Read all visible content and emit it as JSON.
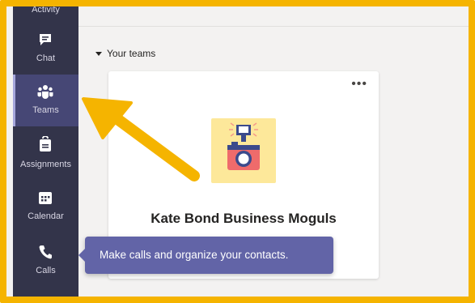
{
  "rail": {
    "items": [
      {
        "label": "Activity",
        "icon": "bell-icon"
      },
      {
        "label": "Chat",
        "icon": "chat-icon"
      },
      {
        "label": "Teams",
        "icon": "teams-icon",
        "active": true
      },
      {
        "label": "Assignments",
        "icon": "assignments-icon"
      },
      {
        "label": "Calendar",
        "icon": "calendar-icon"
      },
      {
        "label": "Calls",
        "icon": "phone-icon"
      }
    ]
  },
  "main": {
    "section_title": "Your teams",
    "team_card": {
      "name": "Kate Bond Business Moguls",
      "more_label": "•••"
    }
  },
  "tooltip": {
    "text": "Make calls and organize your contacts."
  },
  "colors": {
    "frame_border": "#f5b400",
    "rail_bg": "#33344a",
    "accent": "#6264a7",
    "annotation_arrow": "#f5b400"
  }
}
